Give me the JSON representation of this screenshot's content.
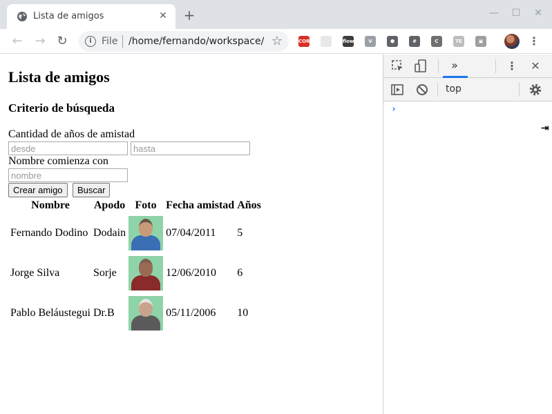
{
  "browser": {
    "tab_title": "Lista de amigos",
    "tab_close": "✕",
    "new_tab": "+",
    "window_controls": {
      "minimize": "—",
      "maximize": "☐",
      "close": "✕"
    },
    "nav": {
      "back": "←",
      "forward": "→",
      "reload": "↻"
    },
    "omnibox": {
      "info": "i",
      "scheme": "File",
      "url": "/home/fernando/workspace/",
      "star": "☆"
    },
    "extensions": [
      {
        "name": "cors-extension",
        "label": "CORS",
        "color": "#d93025"
      },
      {
        "name": "grid-extension",
        "label": "",
        "color": "#e8e8e8"
      },
      {
        "name": "flow-extension",
        "label": "flow",
        "color": "#3c3c3c"
      },
      {
        "name": "vue-extension",
        "label": "V",
        "color": "#9aa0a6"
      },
      {
        "name": "hex-extension",
        "label": "⬢",
        "color": "#5f6368"
      },
      {
        "name": "hash-extension",
        "label": "#",
        "color": "#5f6368"
      },
      {
        "name": "c-extension",
        "label": "C",
        "color": "#6f6f6f"
      },
      {
        "name": "te-extension",
        "label": "TE",
        "color": "#bdbdbd"
      },
      {
        "name": "photo-extension",
        "label": "▣",
        "color": "#9e9e9e"
      }
    ],
    "menu": "⋮"
  },
  "page": {
    "title": "Lista de amigos",
    "subtitle": "Criterio de búsqueda",
    "years_label": "Cantidad de años de amistad",
    "from_placeholder": "desde",
    "to_placeholder": "hasta",
    "name_label": "Nombre comienza con",
    "name_placeholder": "nombre",
    "create_button": "Crear amigo",
    "search_button": "Buscar",
    "table": {
      "headers": [
        "Nombre",
        "Apodo",
        "Foto",
        "Fecha amistad",
        "Años"
      ],
      "rows": [
        {
          "name": "Fernando Dodino",
          "nickname": "Dodain",
          "date": "07/04/2011",
          "years": "5",
          "shirt": "#3a6fb5",
          "skin": "#c99a7a",
          "hair": "#6b5444"
        },
        {
          "name": "Jorge Silva",
          "nickname": "Sorje",
          "date": "12/06/2010",
          "years": "6",
          "shirt": "#8a2a2a",
          "skin": "#9b6a55",
          "hair": "#7a5d50"
        },
        {
          "name": "Pablo Beláustegui",
          "nickname": "Dr.B",
          "date": "05/11/2006",
          "years": "10",
          "shirt": "#5a5a5a",
          "skin": "#c9a38e",
          "hair": "#e6e6e6"
        }
      ]
    }
  },
  "devtools": {
    "context": "top",
    "prompt": "›",
    "more_panels": "»",
    "menu": "⋮",
    "close": "✕"
  }
}
